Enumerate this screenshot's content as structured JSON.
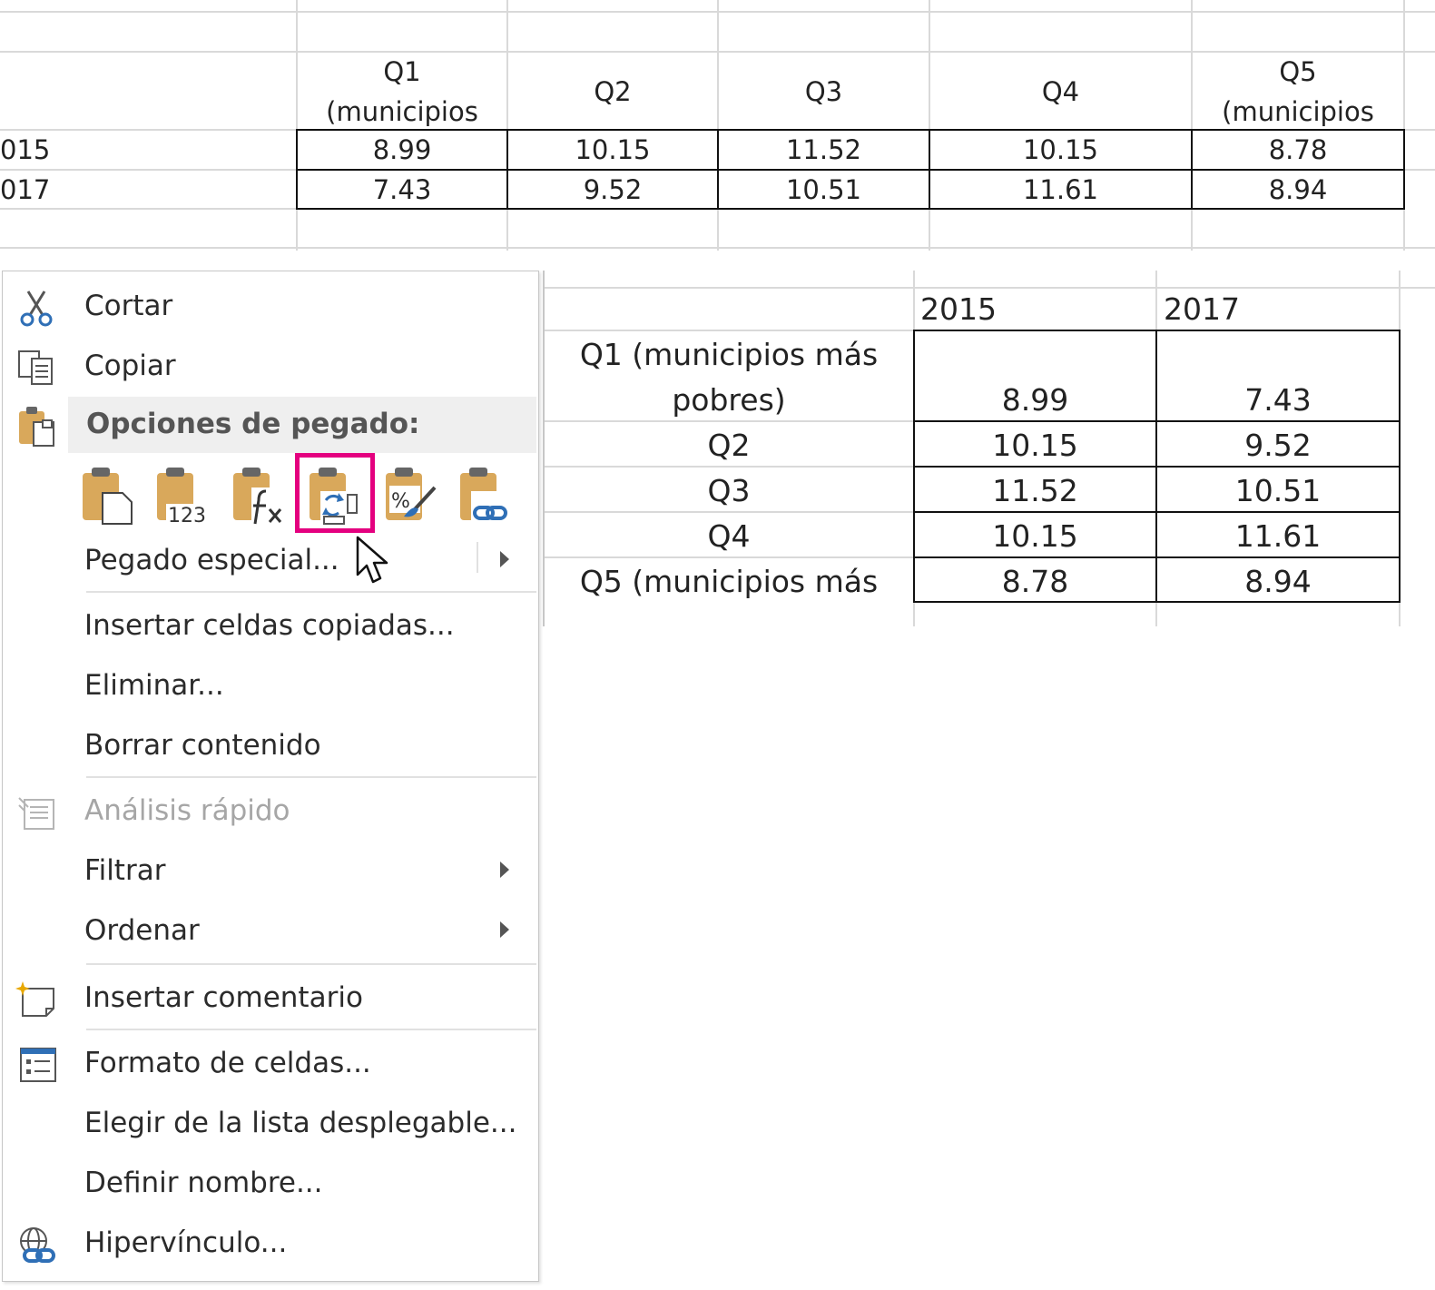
{
  "top_table": {
    "headers": [
      {
        "l1": "Q1",
        "l2": "(municipios"
      },
      {
        "l1": "Q2",
        "l2": ""
      },
      {
        "l1": "Q3",
        "l2": ""
      },
      {
        "l1": "Q4",
        "l2": ""
      },
      {
        "l1": "Q5",
        "l2": "(municipios"
      }
    ],
    "rows": [
      {
        "label": "015",
        "values": [
          "8.99",
          "10.15",
          "11.52",
          "10.15",
          "8.78"
        ]
      },
      {
        "label": "017",
        "values": [
          "7.43",
          "9.52",
          "10.51",
          "11.61",
          "8.94"
        ]
      }
    ]
  },
  "transposed_table": {
    "headers": [
      "2015",
      "2017"
    ],
    "rows": [
      {
        "label_l1": "Q1 (municipios más",
        "label_l2": "pobres)",
        "values": [
          "8.99",
          "7.43"
        ]
      },
      {
        "label_l1": "Q2",
        "label_l2": "",
        "values": [
          "10.15",
          "9.52"
        ]
      },
      {
        "label_l1": "Q3",
        "label_l2": "",
        "values": [
          "11.52",
          "10.51"
        ]
      },
      {
        "label_l1": "Q4",
        "label_l2": "",
        "values": [
          "10.15",
          "11.61"
        ]
      },
      {
        "label_l1": "Q5 (municipios más",
        "label_l2": "",
        "values": [
          "8.78",
          "8.94"
        ]
      }
    ]
  },
  "context_menu": {
    "cut": "Cortar",
    "copy": "Copiar",
    "paste_options": "Opciones de pegado:",
    "paste_icons": [
      "paste-icon",
      "paste-values-icon",
      "paste-formulas-icon",
      "paste-transpose-icon",
      "paste-formatting-icon",
      "paste-link-icon"
    ],
    "paste_icon_123": "123",
    "paste_special": "Pegado especial...",
    "insert_copied": "Insertar celdas copiadas...",
    "delete": "Eliminar...",
    "clear": "Borrar contenido",
    "quick_analysis": "Análisis rápido",
    "filter": "Filtrar",
    "sort": "Ordenar",
    "insert_comment": "Insertar comentario",
    "format_cells": "Formato de celdas...",
    "pick_list": "Elegir de la lista desplegable...",
    "define_name": "Definir nombre...",
    "hyperlink": "Hipervínculo..."
  },
  "colors": {
    "highlight": "#e4007f",
    "icon_blue": "#2f6fb6",
    "clipboard_tan": "#d9a85b"
  }
}
